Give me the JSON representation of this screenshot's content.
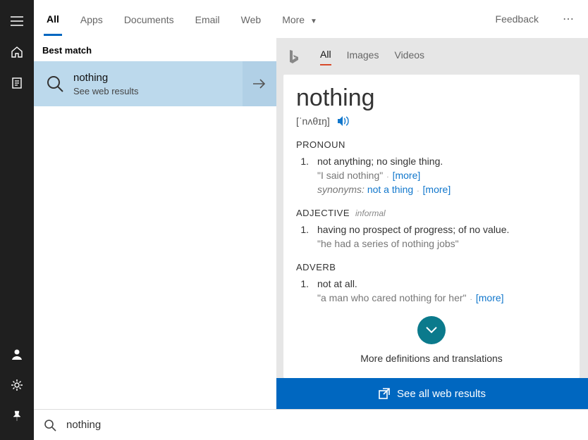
{
  "tabs": {
    "all": "All",
    "apps": "Apps",
    "documents": "Documents",
    "email": "Email",
    "web": "Web",
    "more": "More",
    "feedback": "Feedback"
  },
  "results": {
    "header": "Best match",
    "item": {
      "title": "nothing",
      "subtitle": "See web results"
    }
  },
  "bingTabs": {
    "all": "All",
    "images": "Images",
    "videos": "Videos"
  },
  "dict": {
    "word": "nothing",
    "phon": "[ˈnʌθɪŋ]",
    "pos1": "PRONOUN",
    "def1": "not anything; no single thing.",
    "ex1": "\"I said nothing\"",
    "more1": "[more]",
    "synLabel": "synonyms:",
    "synLink": "not a thing",
    "more1b": "[more]",
    "pos2": "ADJECTIVE",
    "informal": "informal",
    "def2": "having no prospect of progress; of no value.",
    "ex2": "\"he had a series of nothing jobs\"",
    "pos3": "ADVERB",
    "def3": "not at all.",
    "ex3": "\"a man who cared nothing for her\"",
    "more3": "[more]",
    "moreDefs": "More definitions and translations"
  },
  "seeAll": "See all web results",
  "search": {
    "value": "nothing"
  }
}
